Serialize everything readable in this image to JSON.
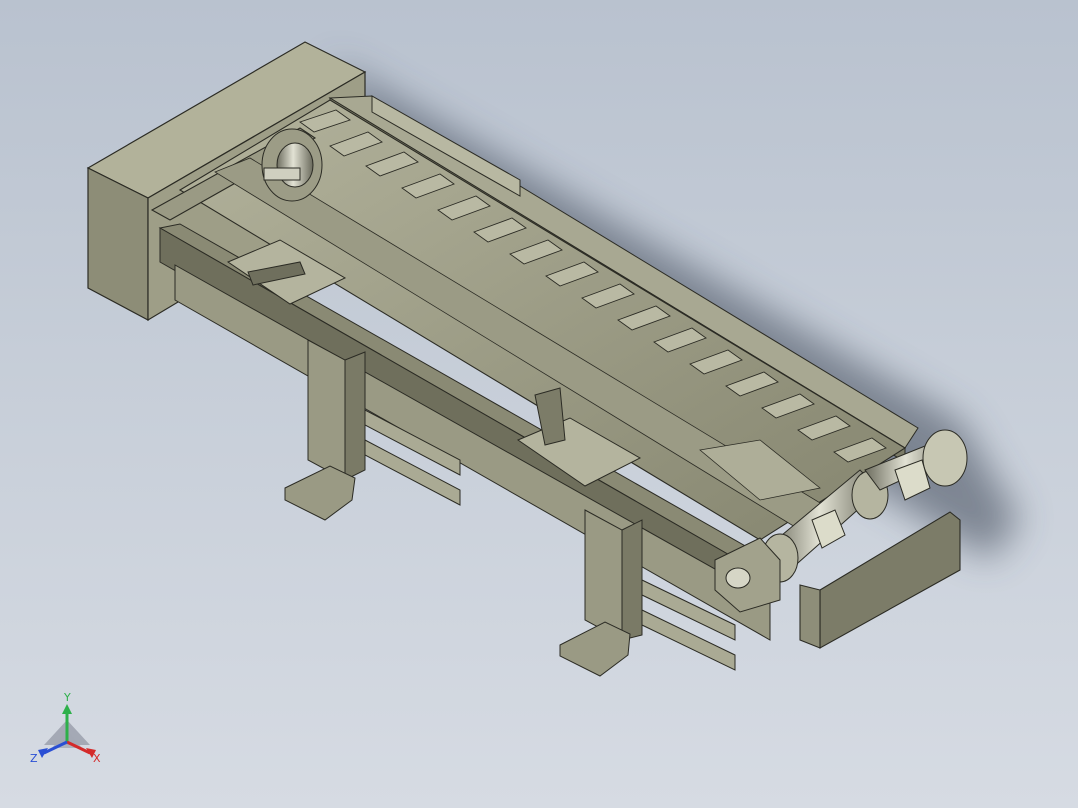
{
  "triad": {
    "x_label": "X",
    "y_label": "Y",
    "z_label": "Z",
    "x_color": "#d42a2a",
    "y_color": "#2db04a",
    "z_color": "#2a4fd4"
  },
  "colors": {
    "background_top": "#b9c2cf",
    "background_bottom": "#d6dbe3",
    "metal_light": "#a6a690",
    "metal_mid": "#8e8e78",
    "metal_dark": "#5f5f50",
    "edge": "#2b2b24"
  }
}
